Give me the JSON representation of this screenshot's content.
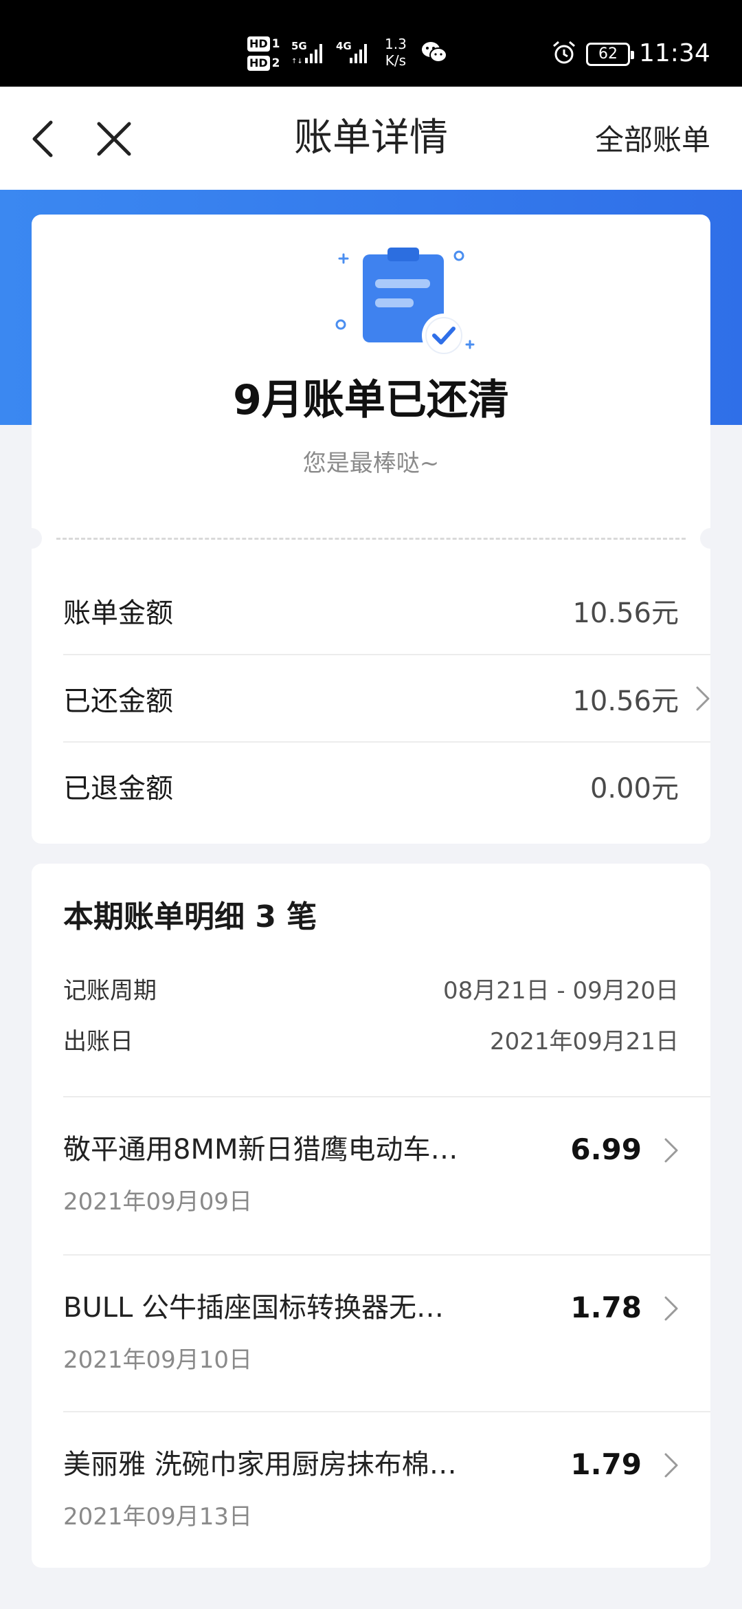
{
  "status_bar": {
    "hd1": "HD",
    "hd1_num": "1",
    "hd2": "HD",
    "hd2_num": "2",
    "sig1_label": "5G",
    "sig2_label": "4G",
    "net_speed_value": "1.3",
    "net_speed_unit": "K/s",
    "battery": "62",
    "time": "11:34"
  },
  "nav": {
    "title": "账单详情",
    "all_bills": "全部账单",
    "back_icon": "chevron-left-icon",
    "close_icon": "close-icon"
  },
  "summary": {
    "title": "9月账单已还清",
    "subtitle": "您是最棒哒~",
    "rows": [
      {
        "label": "账单金额",
        "value": "10.56元"
      },
      {
        "label": "已还金额",
        "value": "10.56元"
      },
      {
        "label": "已退金额",
        "value": "0.00元"
      }
    ]
  },
  "details": {
    "title": "本期账单明细 3 笔",
    "period_label": "记账周期",
    "period_value": "08月21日 - 09月20日",
    "billing_day_label": "出账日",
    "billing_day_value": "2021年09月21日",
    "items": [
      {
        "name": "敬平通用8MM新日猎鹰电动车…",
        "amount": "6.99",
        "date": "2021年09月09日"
      },
      {
        "name": "BULL 公牛插座国标转换器无…",
        "amount": "1.78",
        "date": "2021年09月10日"
      },
      {
        "name": "美丽雅 洗碗巾家用厨房抹布棉…",
        "amount": "1.79",
        "date": "2021年09月13日"
      }
    ]
  },
  "colors": {
    "accent_blue": "#2f6fe8",
    "page_bg": "#f2f3f7"
  }
}
